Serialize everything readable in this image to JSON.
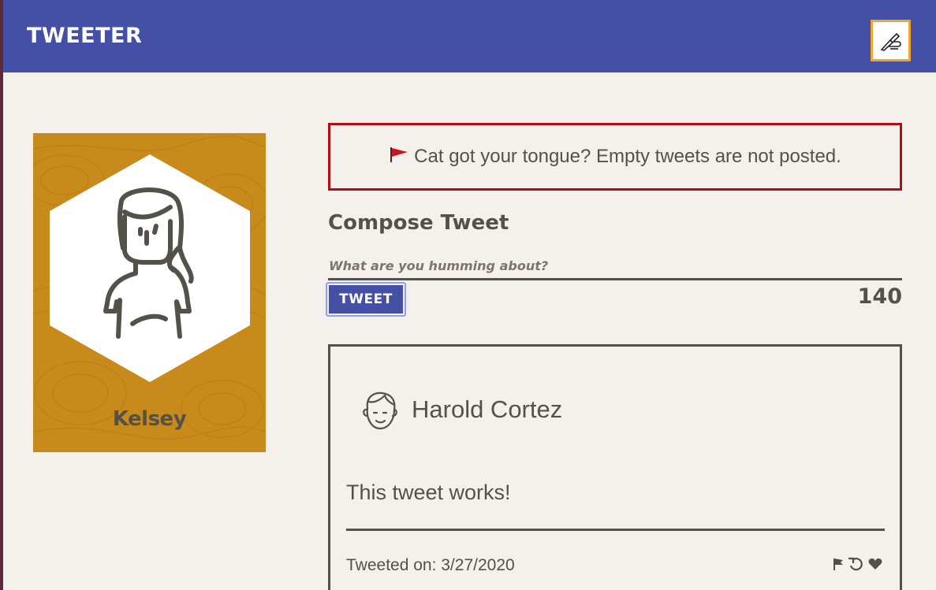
{
  "app": {
    "title": "TWEETER"
  },
  "profile": {
    "name": "Kelsey"
  },
  "error": {
    "message": "Cat got your tongue? Empty tweets are not posted."
  },
  "compose": {
    "title": "Compose Tweet",
    "placeholder": "What are you humming about?",
    "button_label": "TWEET",
    "counter": "140"
  },
  "tweet": {
    "author": "Harold Cortez",
    "body": "This tweet works!",
    "date": "Tweeted on: 3/27/2020"
  },
  "colors": {
    "nav": "#4450a6",
    "accent": "#f2a52a",
    "card": "#c88a1a",
    "error": "#b00d16",
    "text": "#545149"
  },
  "icons": {
    "compose_toggle": "writing-hand-icon",
    "error": "red-flag-icon",
    "actions": [
      "flag-icon",
      "retweet-icon",
      "heart-icon"
    ]
  }
}
